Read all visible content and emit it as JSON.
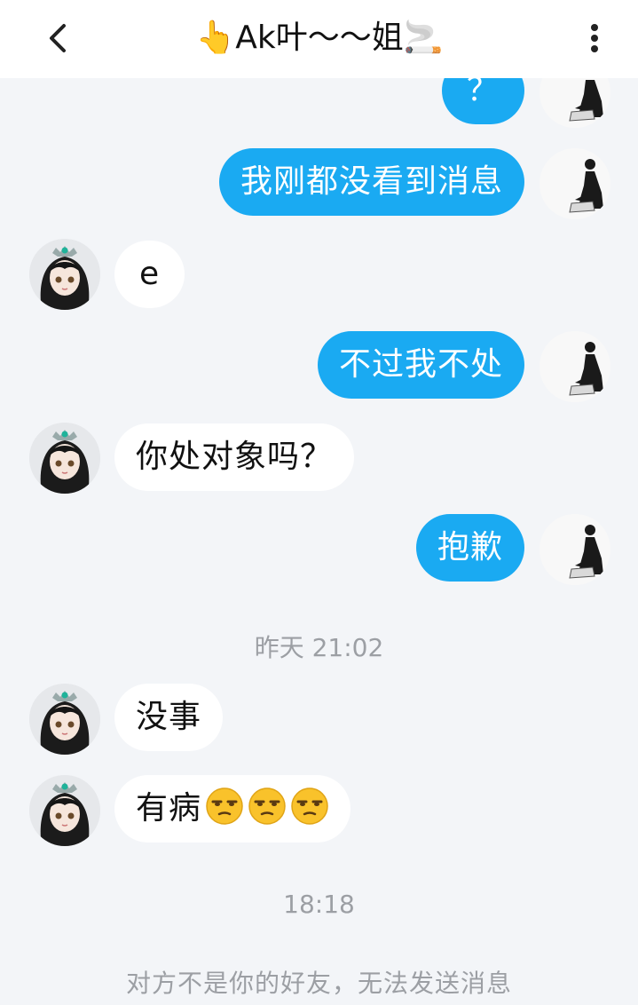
{
  "header": {
    "title": "👆Ak叶～～姐🚬"
  },
  "messages": [
    {
      "side": "out",
      "text": "？"
    },
    {
      "side": "out",
      "text": "我刚都没看到消息"
    },
    {
      "side": "in",
      "text": "e"
    },
    {
      "side": "out",
      "text": "不过我不处"
    },
    {
      "side": "in",
      "text": "你处对象吗？"
    },
    {
      "side": "out",
      "text": "抱歉"
    },
    {
      "side": "in",
      "text": "没事"
    },
    {
      "side": "in",
      "text": "有病"
    }
  ],
  "emoji_icon": "unamused-face-icon",
  "timestamps": [
    "昨天 21:02",
    "18:18"
  ],
  "footer_notice": "对方不是你的好友，无法发送消息",
  "colors": {
    "outgoing_bubble": "#1aaaf2",
    "background": "#f3f5f8"
  }
}
